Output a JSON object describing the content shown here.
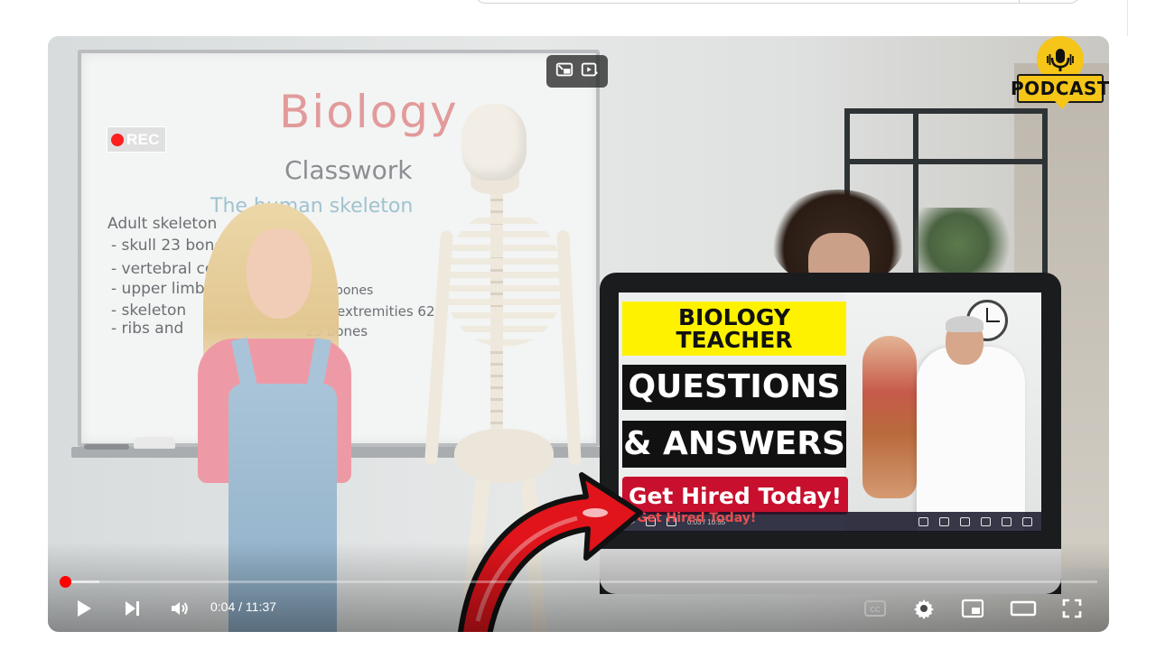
{
  "whiteboard": {
    "title": "Biology",
    "subtitle": "Classwork",
    "topic": "The human skeleton",
    "lines": [
      "Adult skeleton",
      "- skull 23 bones",
      "- vertebral co",
      "- upper limb",
      "- skeleton",
      "- ribs and",
      "bones",
      "extremities 62",
      "25 bones"
    ]
  },
  "overlays": {
    "rec_label": "REC",
    "podcast_label": "PODCAST"
  },
  "thumbnail": {
    "line1": "BIOLOGY",
    "line2": "TEACHER",
    "line3": "QUESTIONS",
    "line4": "& ANSWERS",
    "cta": "Get Hired Today!",
    "cta_echo": "Get Hired Today!",
    "mini_time": "0:03 / 10:55"
  },
  "player": {
    "current_time": "0:04",
    "duration": "11:37",
    "time_display": "0:04 / 11:37",
    "progress": 0.0057,
    "buffered": 0.038,
    "accent_color": "#ff0000"
  },
  "controls": {
    "play": "play-icon",
    "next": "next-icon",
    "volume": "volume-icon",
    "captions": "captions-icon",
    "settings": "gear-icon",
    "miniplayer": "miniplayer-icon",
    "theater": "theater-icon",
    "fullscreen": "fullscreen-icon"
  }
}
